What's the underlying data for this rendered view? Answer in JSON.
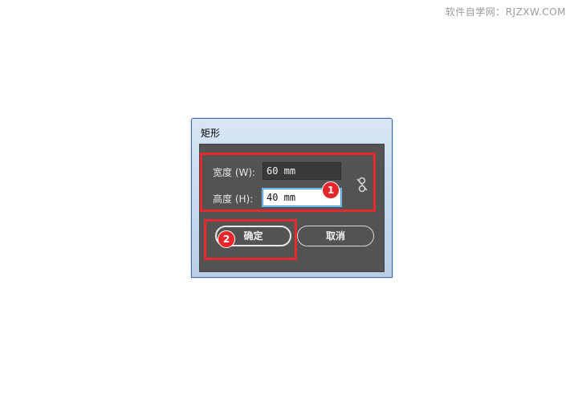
{
  "watermark": "软件自学网：RJZXW.COM",
  "dialog": {
    "title": "矩形",
    "width": {
      "label": "宽度 (W):",
      "value": "60 mm"
    },
    "height": {
      "label": "高度 (H):",
      "value": "40 mm"
    },
    "link_icon": "unlinked-chain-icon",
    "ok_label": "确定",
    "cancel_label": "取消"
  },
  "annotations": {
    "badge_1": "1",
    "badge_2": "2",
    "highlight_color": "#e8282c",
    "badge_color": "#e5262a"
  }
}
